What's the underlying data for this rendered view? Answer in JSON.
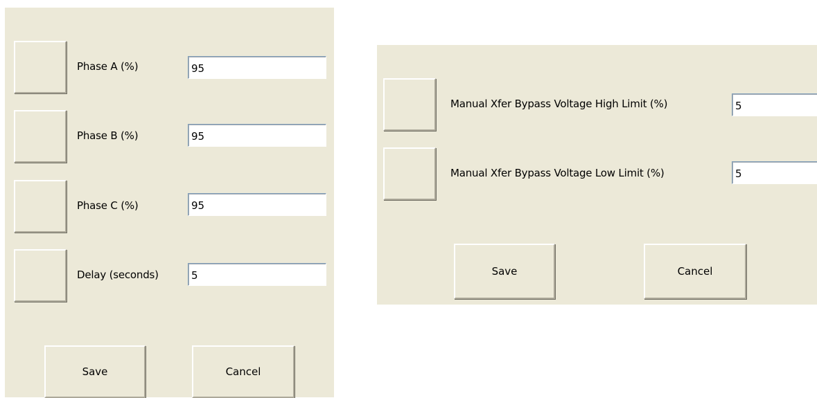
{
  "left_dialog": {
    "fields": [
      {
        "label": "Phase A (%)",
        "value": "95"
      },
      {
        "label": "Phase B (%)",
        "value": "95"
      },
      {
        "label": "Phase C (%)",
        "value": "95"
      },
      {
        "label": "Delay (seconds)",
        "value": "5"
      }
    ],
    "save_label": "Save",
    "cancel_label": "Cancel"
  },
  "right_dialog": {
    "fields": [
      {
        "label": "Manual Xfer Bypass Voltage High Limit (%)",
        "value": "5"
      },
      {
        "label": "Manual Xfer Bypass Voltage Low Limit (%)",
        "value": "5"
      }
    ],
    "save_label": "Save",
    "cancel_label": "Cancel"
  }
}
